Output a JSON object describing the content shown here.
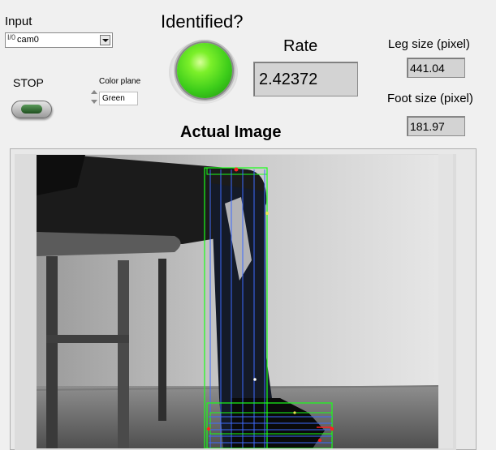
{
  "input": {
    "label": "Input",
    "glyph": "I/0",
    "value": "cam0"
  },
  "stop": {
    "label": "STOP"
  },
  "color_plane": {
    "label": "Color plane",
    "value": "Green"
  },
  "identified": {
    "label": "Identified?",
    "led_color": "#3ccc1a",
    "state": "on"
  },
  "rate": {
    "label": "Rate",
    "value": "2.42372"
  },
  "leg_size": {
    "label": "Leg size (pixel)",
    "value": "441.04"
  },
  "foot_size": {
    "label": "Foot size (pixel)",
    "value": "181.97"
  },
  "image": {
    "title": "Actual Image",
    "overlay_color": "#1aff1a",
    "line_color": "#3d6bff",
    "marker_color": "#ff2020"
  },
  "icons": {
    "input_arrow": "chevron-down-icon",
    "spinner": "spinner-arrows-icon"
  }
}
